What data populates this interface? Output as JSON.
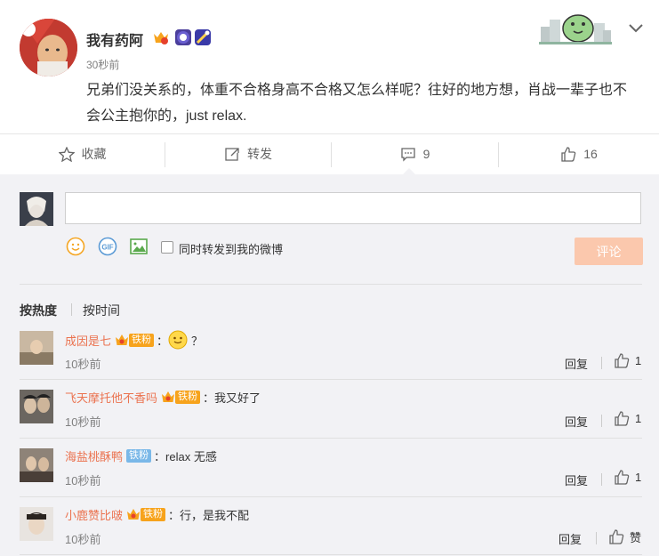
{
  "post": {
    "username": "我有药阿",
    "time": "30秒前",
    "text": "兄弟们没关系的，体重不合格身高不合格又怎么样呢？往好的地方想，肖战一辈子也不会公主抱你的，just relax.",
    "colors": {
      "username": "#333333",
      "text": "#333333"
    }
  },
  "actions": {
    "favorite": "收藏",
    "repost": "转发",
    "comment_count": "9",
    "like_count": "16"
  },
  "compose": {
    "checkbox_label": "同时转发到我的微博",
    "submit_label": "评论",
    "submit_color": "#fbc8ad",
    "icons": [
      "emoji-icon",
      "gif-icon",
      "image-icon"
    ]
  },
  "sort": {
    "hot": "按热度",
    "time": "按时间"
  },
  "comments": [
    {
      "user": "成因是七",
      "fan": "铁粉",
      "text": "？",
      "has_emoji": true,
      "time": "10秒前",
      "reply": "回复",
      "likes": "1"
    },
    {
      "user": "飞天摩托他不香吗",
      "fan": "铁粉",
      "text": "我又好了",
      "time": "10秒前",
      "reply": "回复",
      "likes": "1"
    },
    {
      "user": "海盐桃酥鸭",
      "fan": "铁粉",
      "text": "relax 无感",
      "time": "10秒前",
      "reply": "回复",
      "likes": "1"
    },
    {
      "user": "小鹿赞比啵",
      "fan": "铁粉",
      "text": "行，是我不配",
      "time": "10秒前",
      "reply": "回复",
      "likes": "赞"
    }
  ]
}
